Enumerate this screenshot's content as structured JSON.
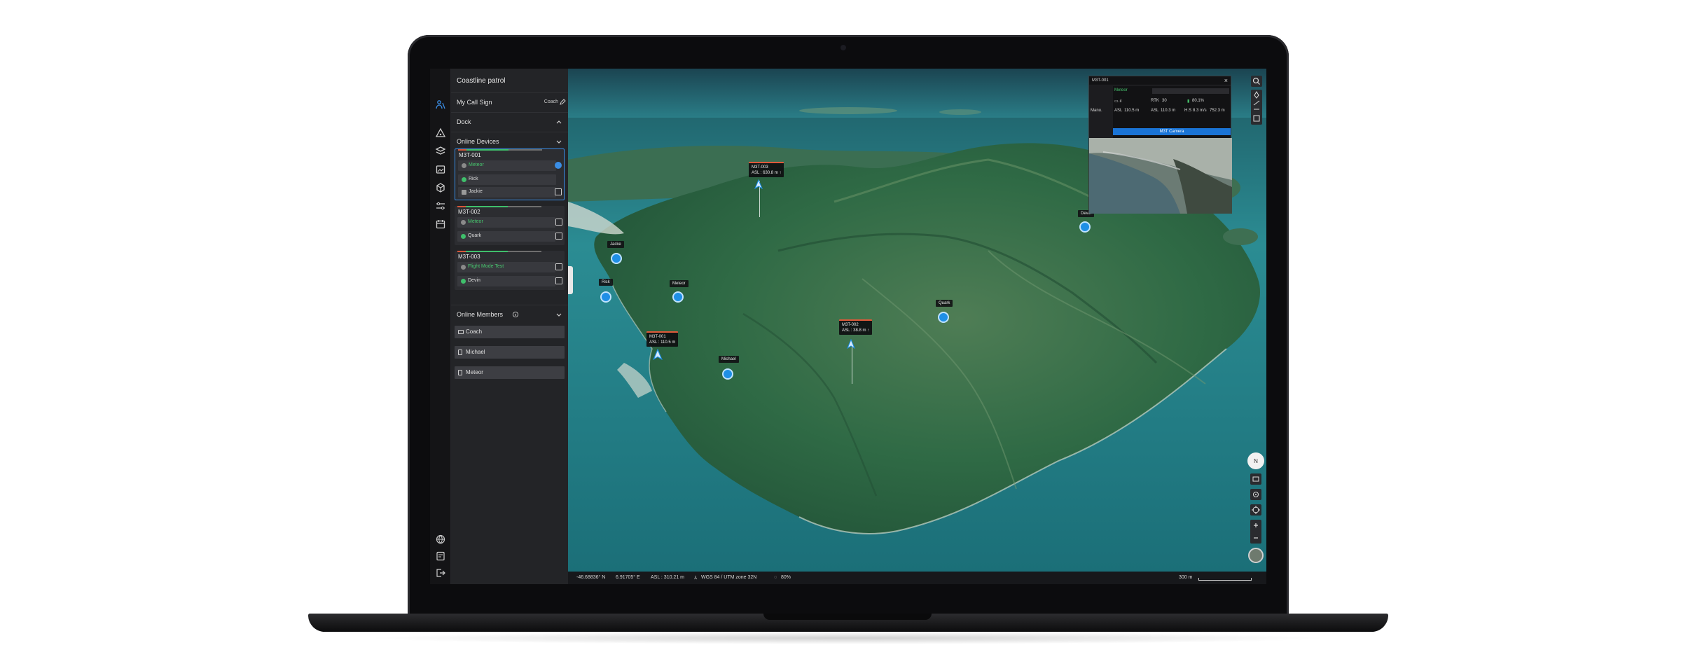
{
  "app": {
    "project_title": "Coastline patrol"
  },
  "sidebar": {
    "call_sign_label": "My Call Sign",
    "call_sign_value": "Coach",
    "dock_label": "Dock",
    "online_devices_label": "Online Devices",
    "online_members_label": "Online Members",
    "devices": [
      {
        "name": "M3T-001",
        "status": "Meteor",
        "pilot": "Rick",
        "payload": "Jackie"
      },
      {
        "name": "M3T-002",
        "status": "Meteor",
        "pilot": "Quark"
      },
      {
        "name": "M3T-003",
        "status": "Flight Mode Test",
        "pilot": "Devin"
      }
    ],
    "members": [
      "Coach",
      "Michael",
      "Meteor"
    ]
  },
  "map": {
    "pins": [
      {
        "label": "Jacke"
      },
      {
        "label": "Rick"
      },
      {
        "label": "Meteor"
      },
      {
        "label": "Michael"
      },
      {
        "label": "Quark"
      },
      {
        "label": "Devin"
      }
    ],
    "drones": [
      {
        "name": "M3T-003",
        "asl": "ASL : 630.8 m ↑"
      },
      {
        "name": "M3T-001",
        "asl": "ASL : 110.5 m"
      },
      {
        "name": "M3T-002",
        "asl": "ASL : 38.8 m ↑"
      }
    ]
  },
  "camera_popup": {
    "title": "M3T-001",
    "operator": "Meteor",
    "mode": "Manu.",
    "rtk_label": "RTK",
    "rtk_value": "30",
    "battery": "80.1%",
    "asl_label": "ASL",
    "asl_value": "110.5 m",
    "alt_label": "ASL",
    "alt_value": "110.3 m",
    "hs_label": "H.S",
    "hs_value": "8.3 m/s",
    "dist_value": "752.3 m",
    "camera_button": "M3T Camera"
  },
  "statusbar": {
    "lat": "-46.68836° N",
    "lon": "6.91705° E",
    "asl": "ASL : 310.21 m",
    "crs": "WGS 84 / UTM zone 32N",
    "loading": "80%",
    "scale": "300 m"
  },
  "colors": {
    "accent_blue": "#1f8fe6",
    "status_green": "#47c66e",
    "sidebar_bg": "#232427"
  }
}
